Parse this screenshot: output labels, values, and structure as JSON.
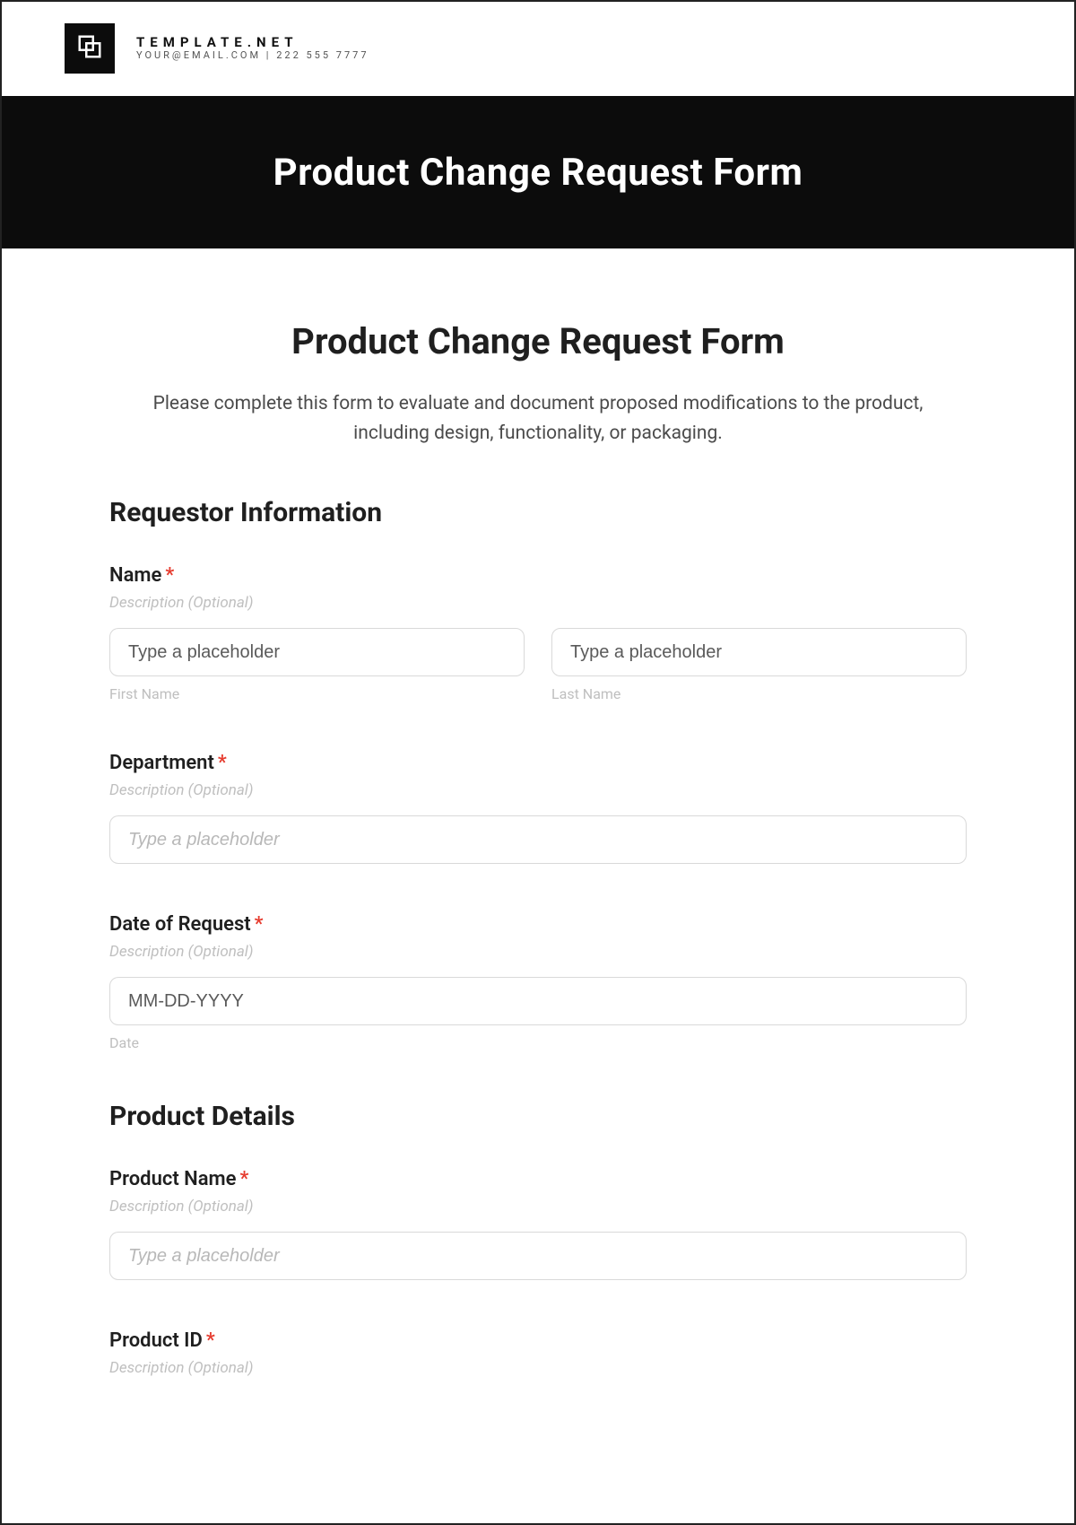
{
  "brand": {
    "name": "TEMPLATE.NET",
    "sub": "YOUR@EMAIL.COM | 222 555 7777"
  },
  "banner": {
    "title": "Product Change Request Form"
  },
  "form": {
    "title": "Product Change Request Form",
    "intro": "Please complete this form to evaluate and document proposed modifications to the product, including design, functionality, or packaging.",
    "desc_placeholder": "Description (Optional)",
    "text_placeholder": "Type a placeholder",
    "date_placeholder": "MM-DD-YYYY",
    "required_mark": "*",
    "sections": {
      "requestor": {
        "heading": "Requestor Information",
        "name": {
          "label": "Name",
          "first_sub": "First Name",
          "last_sub": "Last Name"
        },
        "department": {
          "label": "Department"
        },
        "date": {
          "label": "Date of Request",
          "sub": "Date"
        }
      },
      "product": {
        "heading": "Product Details",
        "product_name": {
          "label": "Product Name"
        },
        "product_id": {
          "label": "Product ID"
        }
      }
    }
  }
}
